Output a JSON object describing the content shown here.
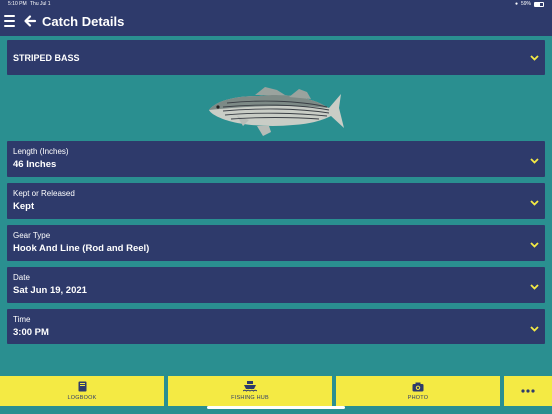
{
  "status_bar": {
    "time": "5:10 PM",
    "date": "Thu Jul 1",
    "battery": "59%"
  },
  "nav": {
    "title": "Catch Details"
  },
  "species": {
    "value": "STRIPED BASS"
  },
  "fields": [
    {
      "label": "Length (Inches)",
      "value": "46 Inches"
    },
    {
      "label": "Kept or Released",
      "value": "Kept"
    },
    {
      "label": "Gear Type",
      "value": "Hook And Line (Rod and Reel)"
    },
    {
      "label": "Date",
      "value": "Sat Jun 19, 2021"
    },
    {
      "label": "Time",
      "value": "3:00 PM"
    }
  ],
  "tabs": [
    {
      "label": "LOGBOOK",
      "icon": "book-icon"
    },
    {
      "label": "FISHING HUB",
      "icon": "boat-icon"
    },
    {
      "label": "PHOTO",
      "icon": "camera-icon"
    },
    {
      "label": "",
      "icon": "more-icon"
    }
  ],
  "colors": {
    "background": "#2a8f90",
    "bar": "#2e3a6b",
    "accent": "#f4ea44",
    "chevron": "#f4ea44"
  }
}
